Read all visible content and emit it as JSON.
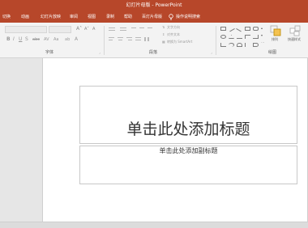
{
  "window": {
    "title": "幻灯片母版 - PowerPoint"
  },
  "menu": {
    "tabs": [
      "切换",
      "动画",
      "幻灯片放映",
      "审阅",
      "视图",
      "录制",
      "帮助",
      "百灯片母版"
    ],
    "tell_me": "操作说明搜索"
  },
  "ribbon": {
    "groups": {
      "font": "字体",
      "paragraph": "段落",
      "drawing": "绘图"
    },
    "paragraph": {
      "text_direction": "文字方向",
      "align_text": "对齐文本",
      "smartart": "转换为 SmartArt"
    },
    "drawing": {
      "arrange": "排列",
      "quick_styles": "快速样式"
    }
  },
  "slide": {
    "title_placeholder": "单击此处添加标题",
    "subtitle_placeholder": "单击此处添加副标题"
  },
  "colors": {
    "accent": "#b7472a"
  }
}
